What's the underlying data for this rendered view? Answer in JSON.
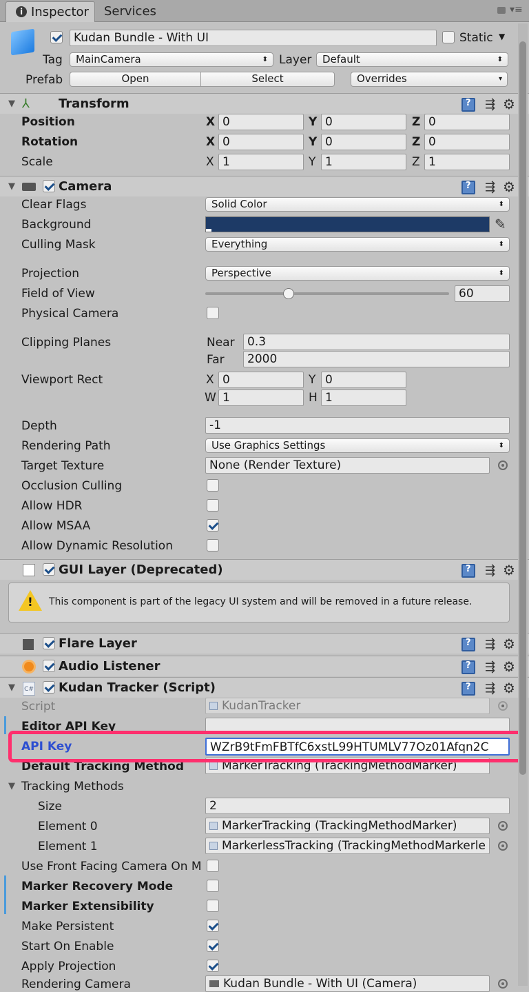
{
  "tabs": {
    "inspector": "Inspector",
    "services": "Services"
  },
  "object": {
    "name": "Kudan Bundle - With UI",
    "static_label": "Static",
    "tag_label": "Tag",
    "tag_value": "MainCamera",
    "layer_label": "Layer",
    "layer_value": "Default",
    "prefab_label": "Prefab",
    "open": "Open",
    "select": "Select",
    "overrides": "Overrides"
  },
  "transform": {
    "title": "Transform",
    "position": "Position",
    "rotation": "Rotation",
    "scale": "Scale",
    "x": "X",
    "y": "Y",
    "z": "Z",
    "pos": [
      "0",
      "0",
      "0"
    ],
    "rot": [
      "0",
      "0",
      "0"
    ],
    "scl": [
      "1",
      "1",
      "1"
    ]
  },
  "camera": {
    "title": "Camera",
    "clear_flags": "Clear Flags",
    "clear_flags_value": "Solid Color",
    "background": "Background",
    "background_color": "#1d3a66",
    "culling_mask": "Culling Mask",
    "culling_mask_value": "Everything",
    "projection": "Projection",
    "projection_value": "Perspective",
    "fov": "Field of View",
    "fov_value": "60",
    "fov_fraction": 0.343,
    "physical": "Physical Camera",
    "clipping": "Clipping Planes",
    "near": "Near",
    "near_value": "0.3",
    "far": "Far",
    "far_value": "2000",
    "viewport": "Viewport Rect",
    "vx": "X",
    "vy": "Y",
    "vw": "W",
    "vh": "H",
    "vx_value": "0",
    "vy_value": "0",
    "vw_value": "1",
    "vh_value": "1",
    "depth": "Depth",
    "depth_value": "-1",
    "rendering_path": "Rendering Path",
    "rendering_path_value": "Use Graphics Settings",
    "target_texture": "Target Texture",
    "target_texture_value": "None (Render Texture)",
    "occlusion": "Occlusion Culling",
    "hdr": "Allow HDR",
    "msaa": "Allow MSAA",
    "dynres": "Allow Dynamic Resolution"
  },
  "gui_layer": {
    "title": "GUI Layer (Deprecated)",
    "warning": "This component is part of the legacy UI system and will be removed in a future release."
  },
  "flare": {
    "title": "Flare Layer"
  },
  "audio": {
    "title": "Audio Listener"
  },
  "kudan": {
    "title": "Kudan Tracker (Script)",
    "script": "Script",
    "script_value": "KudanTracker",
    "editor_key": "Editor API Key",
    "api_key": "API Key",
    "api_key_value": "WZrB9tFmFBTfC6xstL99HTUMLV77Oz01Afqn2C",
    "default_tracking": "Default Tracking Method",
    "default_tracking_value": "MarkerTracking (TrackingMethodMarker)",
    "tracking_methods": "Tracking Methods",
    "size": "Size",
    "size_value": "2",
    "element0": "Element 0",
    "element0_value": "MarkerTracking (TrackingMethodMarker)",
    "element1": "Element 1",
    "element1_value": "MarkerlessTracking (TrackingMethodMarkerle",
    "front_camera": "Use Front Facing Camera On M",
    "marker_recovery": "Marker Recovery Mode",
    "marker_ext": "Marker Extensibility",
    "persistent": "Make Persistent",
    "start_enable": "Start On Enable",
    "apply_proj": "Apply Projection",
    "rendering_camera": "Rendering Camera",
    "rendering_camera_value": "Kudan Bundle - With UI (Camera)"
  },
  "colors": {
    "highlight": "#ff2f6d",
    "accent_blue": "#2d4fd1"
  }
}
